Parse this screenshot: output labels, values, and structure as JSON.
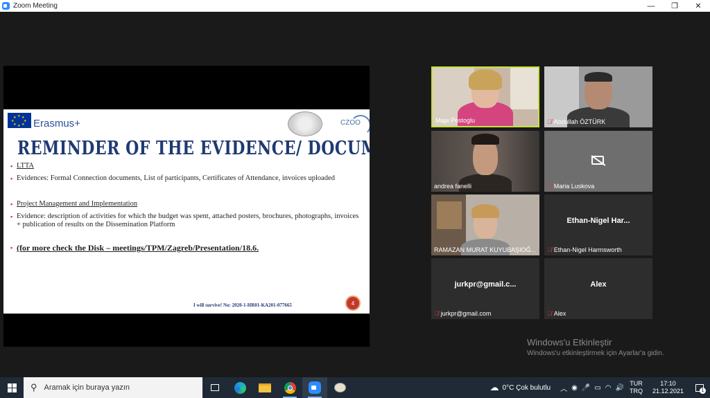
{
  "window": {
    "title": "Zoom Meeting",
    "controls": {
      "minimize": "—",
      "maximize": "❐",
      "close": "✕"
    }
  },
  "slide": {
    "brand": "Erasmus+",
    "partner_logo": "CZOO",
    "title": "REMINDER OF THE EVIDENCE/ DOCUMENTATION:",
    "bullets": [
      "LTTA",
      "Evidences: Formal Connection documents, List of participants, Certificates of Attendance, invoices uploaded",
      "Project Management and Implementation",
      "Evidence: description of activities for which the budget was spent, attached posters, brochures, photographs, invoices + publication of results on the Dissemination Platform",
      "(for more check the Disk – meetings/TPM/Zagreb/Presentation/18.6."
    ],
    "footer": "I will survive! No: 2020-1-HR01-KA201-077665",
    "page_number": "4"
  },
  "participants": [
    {
      "name": "Maja Postoglu",
      "muted": false,
      "video": true,
      "active_speaker": true
    },
    {
      "name": "Abdullah ÖZTÜRK",
      "muted": true,
      "video": true
    },
    {
      "name": "andrea fanelli",
      "muted": false,
      "video": true
    },
    {
      "name": "Maria Luskova",
      "muted": true,
      "video": false,
      "camera_off_icon": "camera-off-icon"
    },
    {
      "name": "RAMAZAN MURAT KUYUBAŞIOĞ...",
      "muted": false,
      "video": true
    },
    {
      "name": "Ethan-Nigel Harmsworth",
      "display": "Ethan-Nigel Har...",
      "muted": true,
      "video": false
    },
    {
      "name": "jurkpr@gmail.com",
      "display": "jurkpr@gmail.c...",
      "muted": true,
      "video": false
    },
    {
      "name": "Alex",
      "display": "Alex",
      "muted": true,
      "video": false
    }
  ],
  "watermark": {
    "line1": "Windows'u Etkinleştir",
    "line2": "Windows'u etkinleştirmek için Ayarlar'a gidin."
  },
  "taskbar": {
    "search_placeholder": "Aramak için buraya yazın",
    "weather": "0°C  Çok bulutlu",
    "lang_top": "TUR",
    "lang_bottom": "TRQ",
    "time": "17:10",
    "date": "21.12.2021",
    "notifications": "1"
  },
  "colors": {
    "active_speaker_border": "#c6e33b",
    "mute_red": "#e53935",
    "slide_title": "#1f3a73"
  }
}
